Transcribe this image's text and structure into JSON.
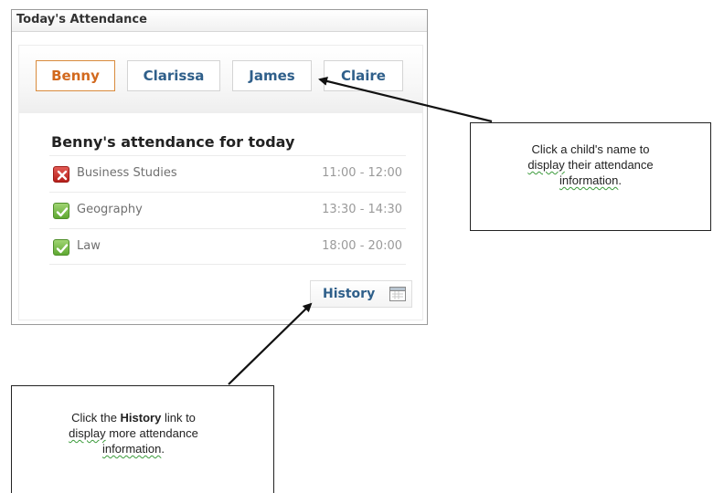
{
  "widget": {
    "title": "Today's Attendance",
    "tabs": [
      {
        "label": "Benny",
        "active": true
      },
      {
        "label": "Clarissa",
        "active": false
      },
      {
        "label": "James",
        "active": false
      },
      {
        "label": "Claire",
        "active": false
      }
    ],
    "heading": "Benny's attendance for today",
    "rows": [
      {
        "subject": "Business Studies",
        "time": "11:00 - 12:00",
        "status": "absent",
        "icon": "cross-icon"
      },
      {
        "subject": "Geography",
        "time": "13:30 - 14:30",
        "status": "present",
        "icon": "check-icon"
      },
      {
        "subject": "Law",
        "time": "18:00 - 20:00",
        "status": "present",
        "icon": "check-icon"
      }
    ],
    "history_label": "History",
    "history_icon": "calendar-icon"
  },
  "callouts": {
    "names": {
      "line1": "Click a child's name to",
      "word_display": "display",
      "line2_rest": " their attendance",
      "word_information": "information",
      "end": "."
    },
    "history": {
      "pre": "Click the ",
      "bold": "History",
      "post": " link to",
      "word_display": "display",
      "line2_rest": " more attendance",
      "word_information": "information",
      "end": "."
    }
  },
  "colors": {
    "tab_active": "#d2691e",
    "tab_text": "#2f5f8a",
    "absent": "#c4302b",
    "present": "#6cb33f"
  }
}
